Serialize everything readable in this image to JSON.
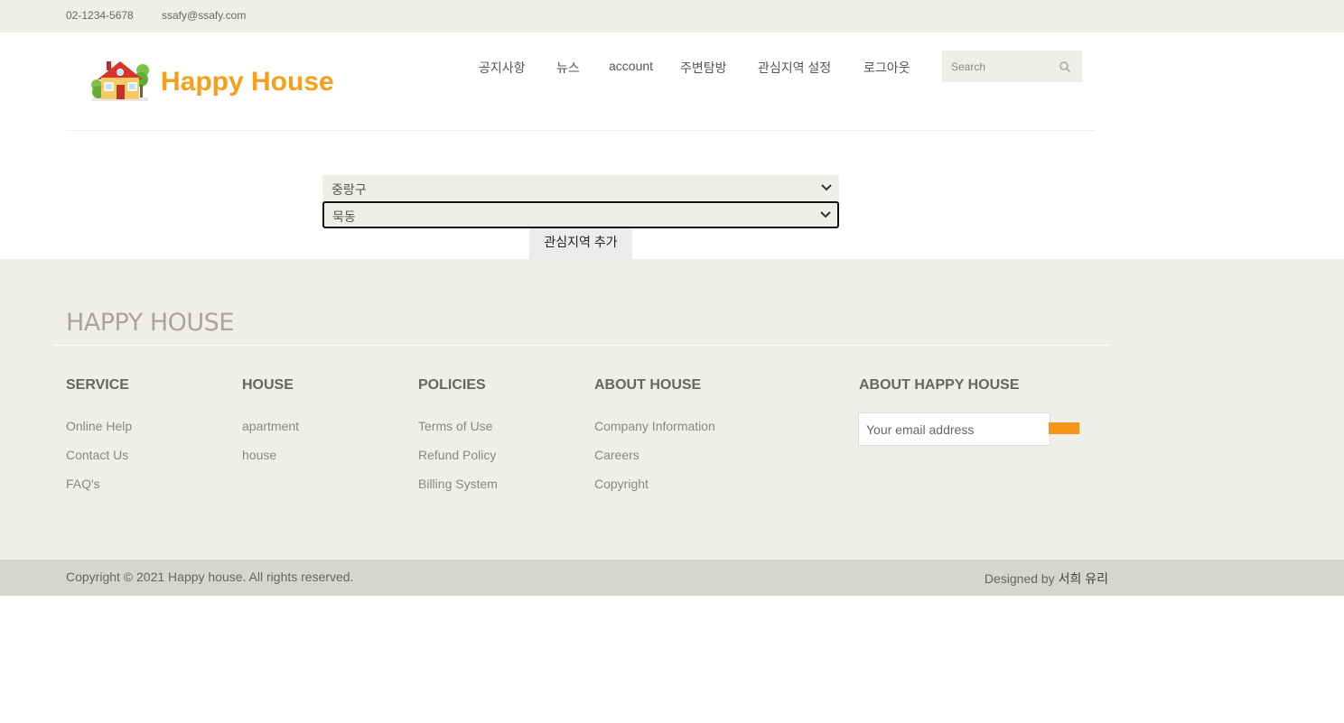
{
  "topbar": {
    "phone": "02-1234-5678",
    "email": "ssafy@ssafy.com"
  },
  "header": {
    "brand": "Happy House",
    "nav": [
      "공지사항",
      "뉴스",
      "account",
      "주변탐방",
      "관심지역 설정",
      "로그아웃"
    ],
    "search_placeholder": "Search"
  },
  "main": {
    "district_select": "중랑구",
    "dong_select": "묵동",
    "add_button": "관심지역 추가"
  },
  "footer": {
    "title": "HAPPY HOUSE",
    "columns": [
      {
        "heading": "SERVICE",
        "links": [
          "Online Help",
          "Contact Us",
          "FAQ's"
        ]
      },
      {
        "heading": "HOUSE",
        "links": [
          "apartment",
          "house"
        ]
      },
      {
        "heading": "POLICIES",
        "links": [
          "Terms of Use",
          "Refund Policy",
          "Billing System"
        ]
      },
      {
        "heading": "ABOUT HOUSE",
        "links": [
          "Company Information",
          "Careers",
          "Copyright"
        ]
      }
    ],
    "newsletter": {
      "heading": "ABOUT HAPPY HOUSE",
      "placeholder": "Your email address"
    },
    "copyright": "Copyright © 2021 Happy house. All rights reserved.",
    "designed_prefix": "Designed by",
    "designed_names": "서희 유리"
  },
  "colors": {
    "accent": "#f5a01a",
    "button": "#f5961a",
    "beige": "#efeee9",
    "bottombar": "#d6d6d1"
  },
  "icons": [
    "house-logo-icon",
    "search-icon",
    "chevron-down-icon"
  ]
}
